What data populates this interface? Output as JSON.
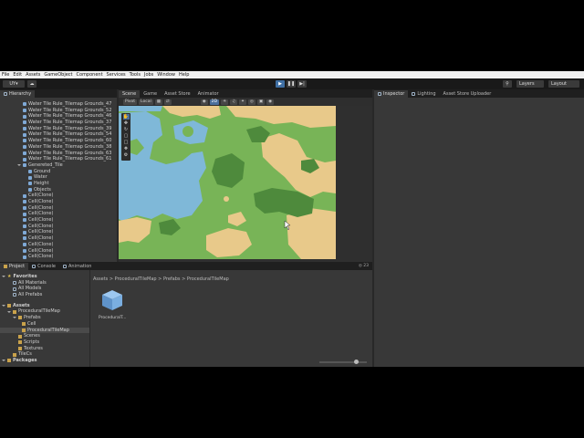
{
  "menu": [
    "File",
    "Edit",
    "Assets",
    "GameObject",
    "Component",
    "Services",
    "Tools",
    "Jobs",
    "Window",
    "Help"
  ],
  "toolbar": {
    "account": "UY",
    "play_icon": "play-icon",
    "pause_icon": "pause-icon",
    "step_icon": "step-icon",
    "layers": "Layers",
    "layout": "Layout"
  },
  "hierarchy": {
    "tab": "Hierarchy",
    "items": [
      "Water Tile Rule_Tilemap Grounds_47",
      "Water Tile Rule_Tilemap Grounds_52",
      "Water Tile Rule_Tilemap Grounds_46",
      "Water Tile Rule_Tilemap Grounds_37",
      "Water Tile Rule_Tilemap Grounds_39",
      "Water Tile Rule_Tilemap Grounds_54",
      "Water Tile Rule_Tilemap Grounds_60",
      "Water Tile Rule_Tilemap Grounds_38",
      "Water Tile Rule_Tilemap Grounds_63",
      "Water Tile Rule_Tilemap Grounds_61",
      "Genereted_Tile",
      "Ground",
      "Water",
      "Height",
      "Objects",
      "Cell(Clone)",
      "Cell(Clone)",
      "Cell(Clone)",
      "Cell(Clone)",
      "Cell(Clone)",
      "Cell(Clone)",
      "Cell(Clone)",
      "Cell(Clone)",
      "Cell(Clone)",
      "Cell(Clone)",
      "Cell(Clone)"
    ]
  },
  "center_tabs": [
    "Scene",
    "Game",
    "Asset Store",
    "Animator"
  ],
  "scene_toolbar": {
    "pivot": "Pivot",
    "local": "Local",
    "mode": "2D"
  },
  "right_tabs": [
    "Inspector",
    "Lighting",
    "Asset Store Uploader"
  ],
  "bottom_tabs": [
    "Project",
    "Console",
    "Animation"
  ],
  "bottom_count": "23",
  "project_tree": {
    "favorites": "Favorites",
    "favorite_items": [
      "All Materials",
      "All Models",
      "All Prefabs"
    ],
    "assets": "Assets",
    "asset_items": [
      "ProceduralTileMap",
      "Prefabs",
      "Cell",
      "ProceduralTileMap",
      "Scenes",
      "Scripts",
      "Textures",
      "TileCs"
    ],
    "packages": "Packages"
  },
  "breadcrumb": [
    "Assets",
    "ProceduralTileMap",
    "Prefabs",
    "ProceduralTileMap"
  ],
  "asset_tile_label": "ProceduralT...",
  "colors": {
    "grass": "#78b457",
    "dark_grass": "#4e8a3c",
    "sand": "#e8c98a",
    "water": "#7fb8d8",
    "accent": "#4a6f9c"
  }
}
